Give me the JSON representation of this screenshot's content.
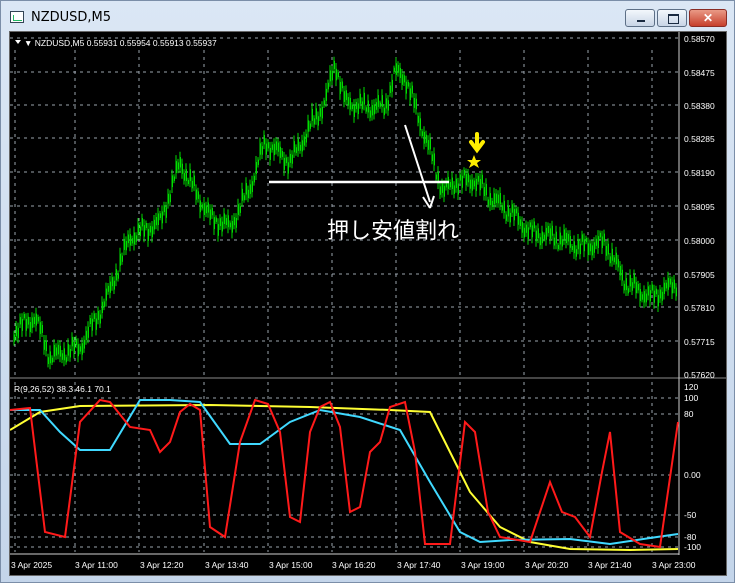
{
  "window": {
    "title": "NZDUSD,M5",
    "buttons": {
      "minimize": "minimize",
      "maximize": "maximize",
      "close": "✕"
    }
  },
  "main_chart": {
    "header": "▼ NZDUSD,M5  0.55931 0.55954 0.55913 0.55937",
    "y_ticks": [
      "0.58570",
      "0.58475",
      "0.58380",
      "0.58285",
      "0.58190",
      "0.58095",
      "0.58000",
      "0.57905",
      "0.57810",
      "0.57715",
      "0.57620"
    ],
    "annotation_text": "押し安値割れ",
    "colors": {
      "background": "#000000",
      "candles": "#00dd00",
      "grid": "#9aa3ad",
      "annotation": "#ffffff",
      "marker": "#ffee00"
    }
  },
  "indicator": {
    "header": "R(9,26,52) 38.3 46.1 70.1",
    "y_ticks": [
      "120",
      "100",
      "80",
      "0.00",
      "-50",
      "-80",
      "-100"
    ],
    "colors": {
      "red": "#ff1a1a",
      "cyan": "#40d9ff",
      "yellow": "#ffff33"
    }
  },
  "x_axis": {
    "labels": [
      "3 Apr 2025",
      "3 Apr 11:00",
      "3 Apr 12:20",
      "3 Apr 13:40",
      "3 Apr 15:00",
      "3 Apr 16:20",
      "3 Apr 17:40",
      "3 Apr 19:00",
      "3 Apr 20:20",
      "3 Apr 21:40",
      "3 Apr 23:00"
    ]
  }
}
